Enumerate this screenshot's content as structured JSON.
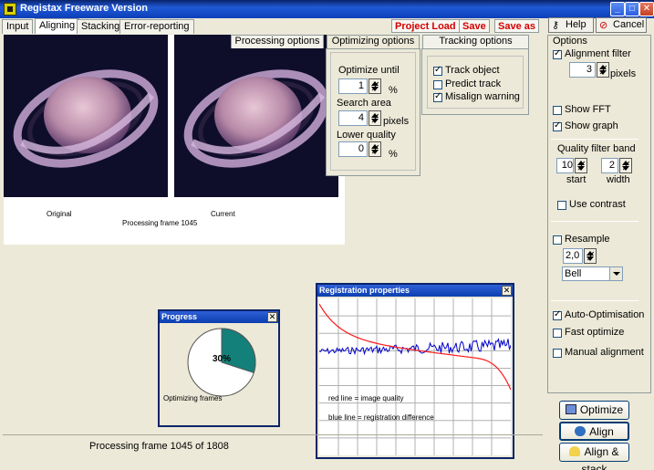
{
  "window": {
    "title": "Registax Freeware Version"
  },
  "menu": {
    "tabs": [
      "Input",
      "Aligning",
      "Stacking",
      "Error-reporting"
    ],
    "active": 1
  },
  "actions": {
    "project_load": "Project Load",
    "save": "Save",
    "save_as": "Save as"
  },
  "top_buttons": {
    "help": "Help",
    "cancel": "Cancel"
  },
  "images": {
    "original_caption": "Original",
    "current_caption": "Current",
    "processing_caption": "Processing frame 1045"
  },
  "option_tabs": {
    "processing": "Processing options",
    "optimizing": "Optimizing options",
    "tracking": "Tracking options"
  },
  "optimizing": {
    "optimize_until_label": "Optimize until",
    "optimize_until_value": "1",
    "optimize_until_unit": "%",
    "search_area_label": "Search area",
    "search_area_value": "4",
    "search_area_unit": "pixels",
    "lower_quality_label": "Lower quality",
    "lower_quality_value": "0",
    "lower_quality_unit": "%"
  },
  "tracking": {
    "track_object": "Track object",
    "track_object_checked": true,
    "predict_track": "Predict track",
    "predict_track_checked": false,
    "misalign_warning": "Misalign warning",
    "misalign_warning_checked": true
  },
  "options": {
    "title": "Options",
    "alignment_filter": "Alignment filter",
    "alignment_filter_checked": true,
    "alignment_filter_value": "3",
    "alignment_filter_unit": "pixels",
    "show_fft": "Show FFT",
    "show_fft_checked": false,
    "show_graph": "Show graph",
    "show_graph_checked": true,
    "quality_band_title": "Quality filter band",
    "start_value": "10",
    "start_label": "start",
    "width_value": "2",
    "width_label": "width",
    "use_contrast": "Use contrast",
    "use_contrast_checked": false,
    "resample": "Resample",
    "resample_checked": false,
    "resample_value": "2,0",
    "resample_filter": "Bell",
    "auto_optimisation": "Auto-Optimisation",
    "auto_optimisation_checked": true,
    "fast_optimize": "Fast optimize",
    "fast_optimize_checked": false,
    "manual_alignment": "Manual alignment",
    "manual_alignment_checked": false
  },
  "buttons": {
    "optimize": "Optimize",
    "align": "Align",
    "align_stack": "Align & stack"
  },
  "progress": {
    "title": "Progress",
    "percent_label": "30%",
    "percent": 30,
    "status": "Optimizing frames"
  },
  "registration": {
    "title": "Registration properties",
    "red_legend": "red  line = image quality",
    "blue_legend": "blue line = registration difference"
  },
  "status": {
    "text": "Processing frame 1045 of 1808"
  },
  "colors": {
    "titlebar": "#0a3fb0",
    "action_red": "#d40000",
    "pie_fill": "#13807a",
    "red_line": "#ff1a1a",
    "blue_line": "#0000cc"
  }
}
